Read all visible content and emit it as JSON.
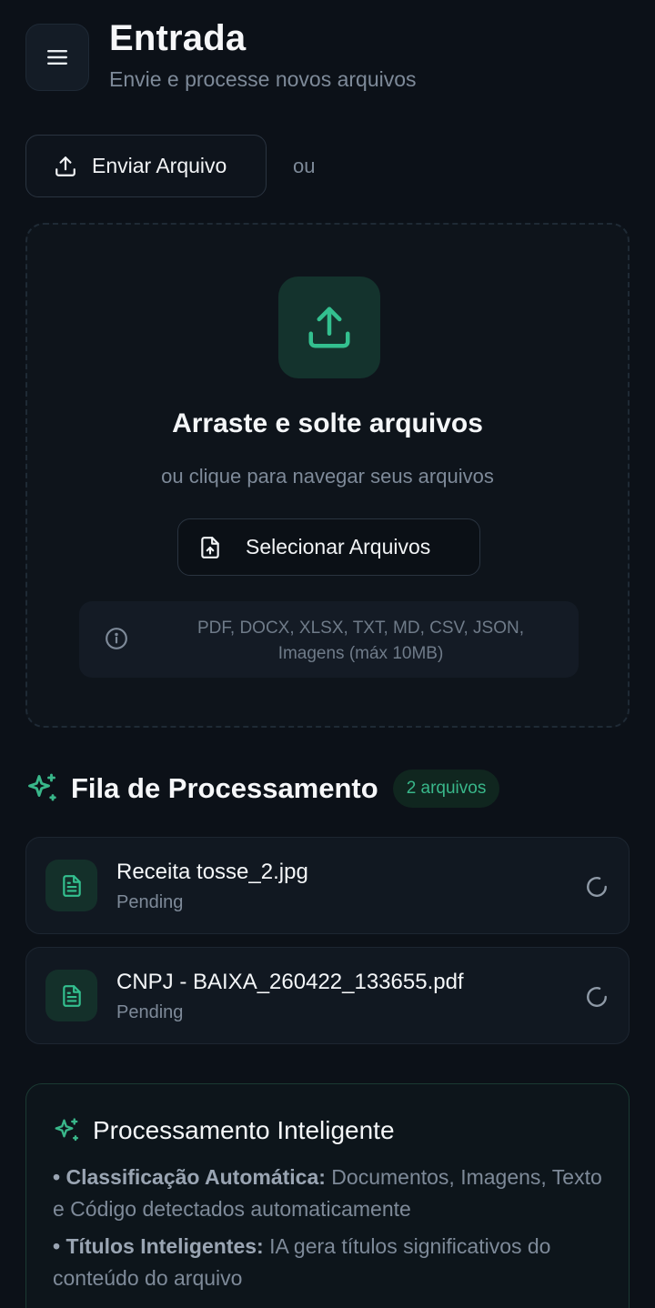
{
  "header": {
    "title": "Entrada",
    "subtitle": "Envie e processe novos arquivos",
    "menu_icon": "menu-icon"
  },
  "upload": {
    "button_label": "Enviar Arquivo",
    "or_text": "ou"
  },
  "dropzone": {
    "title": "Arraste e solte arquivos",
    "subtitle": "ou clique para navegar seus arquivos",
    "select_label": "Selecionar Arquivos",
    "formats_line1": "PDF, DOCX, XLSX, TXT, MD, CSV, JSON,",
    "formats_line2": "Imagens (máx 10MB)"
  },
  "queue": {
    "title": "Fila de Processamento",
    "badge": "2 arquivos",
    "files": [
      {
        "name": "Receita tosse_2.jpg",
        "status": "Pending"
      },
      {
        "name": "CNPJ - BAIXA_260422_133655.pdf",
        "status": "Pending"
      }
    ]
  },
  "smart": {
    "title": "Processamento Inteligente",
    "items": [
      {
        "bullet": "• ",
        "label": "Classificação Automática:",
        "text": " Documentos, Imagens, Texto e Código detectados automaticamente"
      },
      {
        "bullet": "• ",
        "label": "Títulos Inteligentes:",
        "text": " IA gera títulos significativos do conteúdo do arquivo"
      }
    ]
  },
  "colors": {
    "background": "#0c1118",
    "accent": "#39b78a",
    "muted_text": "#7e8a99"
  }
}
